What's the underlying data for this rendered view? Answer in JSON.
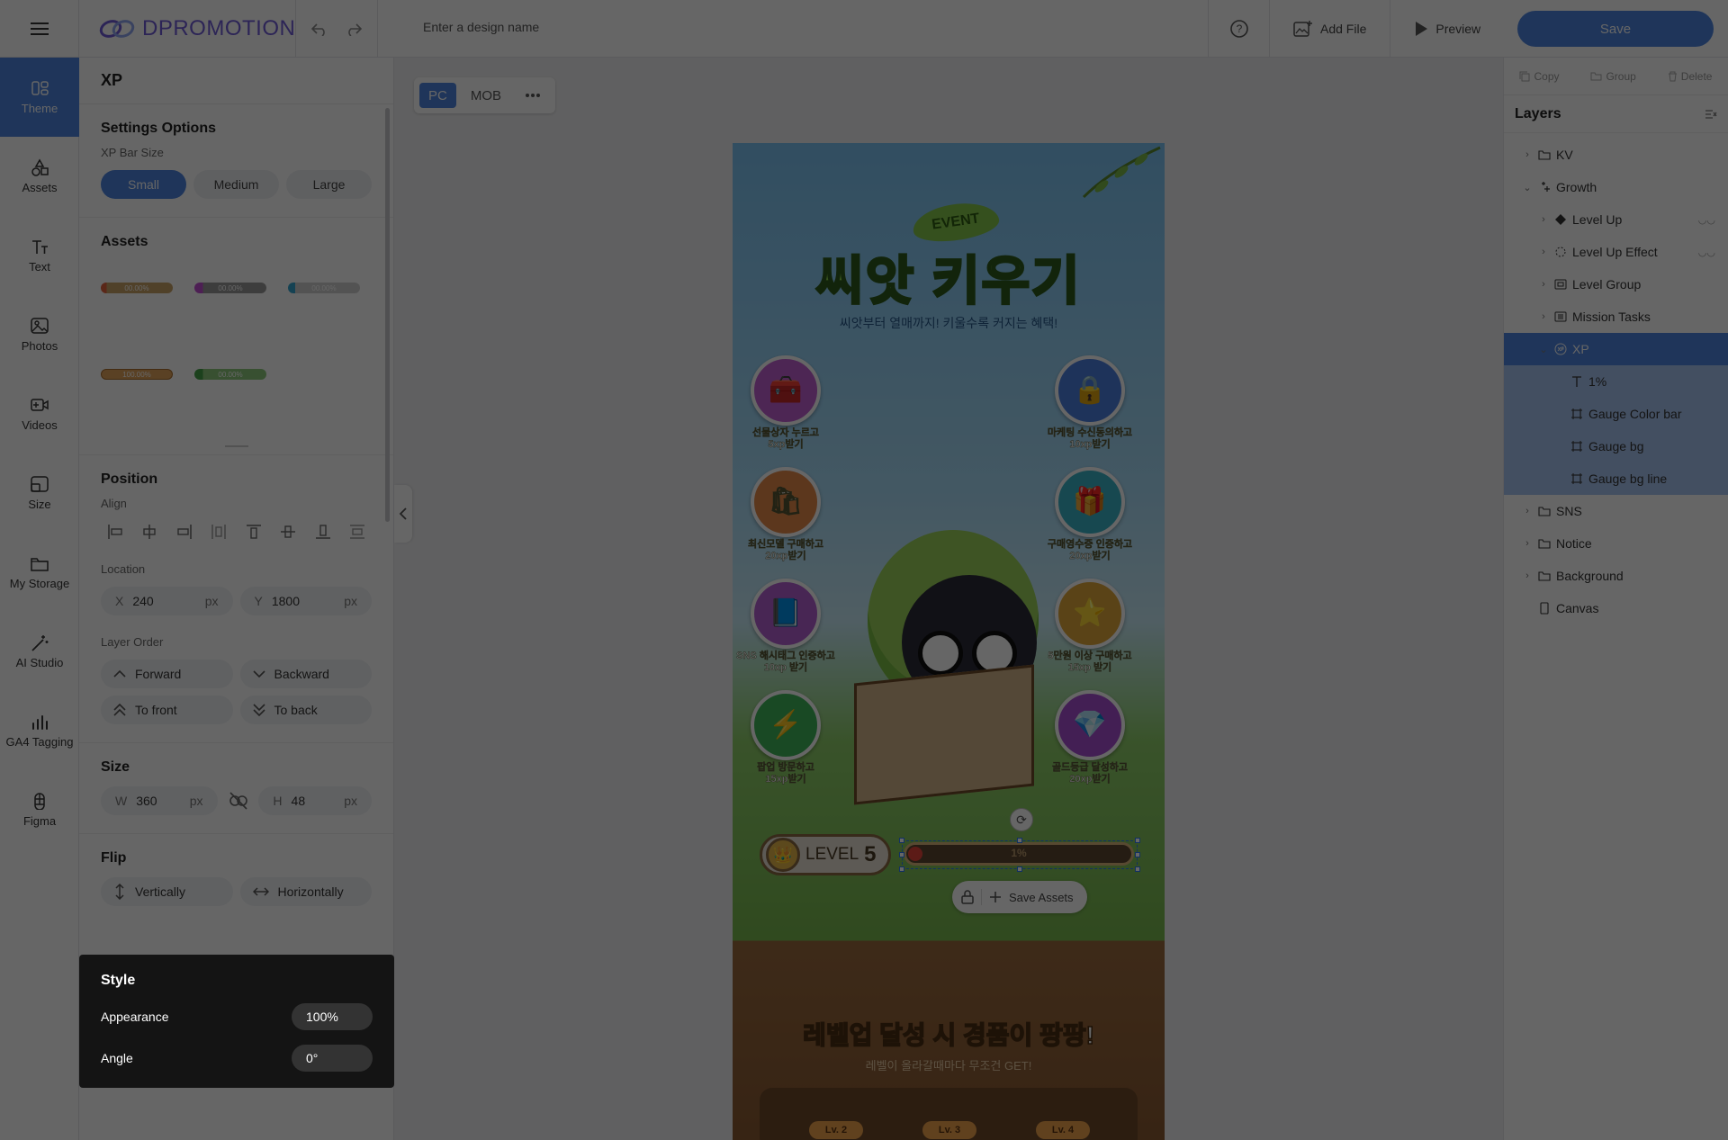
{
  "topbar": {
    "logo": "DPROMOTION",
    "design_name_placeholder": "Enter a design name",
    "add_file": "Add File",
    "preview": "Preview",
    "save": "Save"
  },
  "rail": [
    {
      "label": "Theme",
      "icon": "theme-icon"
    },
    {
      "label": "Assets",
      "icon": "shapes-icon"
    },
    {
      "label": "Text",
      "icon": "text-icon"
    },
    {
      "label": "Photos",
      "icon": "image-icon"
    },
    {
      "label": "Videos",
      "icon": "video-icon"
    },
    {
      "label": "Size",
      "icon": "size-icon"
    },
    {
      "label": "My Storage",
      "icon": "folder-icon"
    },
    {
      "label": "AI Studio",
      "icon": "magic-wand-icon"
    },
    {
      "label": "GA4 Tagging",
      "icon": "chart-icon"
    },
    {
      "label": "Figma",
      "icon": "figma-icon"
    }
  ],
  "panel": {
    "title": "XP",
    "settings_heading": "Settings Options",
    "xp_bar_size_label": "XP Bar Size",
    "sizes": [
      "Small",
      "Medium",
      "Large"
    ],
    "selected_size": "Small",
    "assets_heading": "Assets",
    "asset_labels": [
      "00.00%",
      "00.00%",
      "00.00%",
      "100.00%",
      "00.00%"
    ],
    "position_heading": "Position",
    "align_label": "Align",
    "location_label": "Location",
    "x_key": "X",
    "x_value": "240",
    "y_key": "Y",
    "y_value": "1800",
    "unit": "px",
    "layer_order_label": "Layer Order",
    "forward": "Forward",
    "backward": "Backward",
    "to_front": "To front",
    "to_back": "To back",
    "size_heading": "Size",
    "w_key": "W",
    "w_value": "360",
    "h_key": "H",
    "h_value": "48",
    "flip_heading": "Flip",
    "vertically": "Vertically",
    "horizontally": "Horizontally"
  },
  "style": {
    "heading": "Style",
    "appearance_label": "Appearance",
    "appearance_value": "100%",
    "angle_label": "Angle",
    "angle_value": "0°"
  },
  "canvas": {
    "devices": [
      "PC",
      "MOB"
    ],
    "active_device": "PC",
    "event_badge": "EVENT",
    "title": "씨앗 키우기",
    "subtitle": "씨앗부터 열매까지! 키울수록 커지는 혜택!",
    "missions": [
      {
        "line1": "선물상자 누르고",
        "line2": "5xp받기",
        "icon": "🧰",
        "color": "#c05fd1"
      },
      {
        "line1": "마케팅 수신동의하고",
        "line2": "10xp받기",
        "icon": "🔒",
        "color": "#4d7fe0"
      },
      {
        "line1": "최신모델 구매하고",
        "line2": "20xp받기",
        "icon": "🛍",
        "color": "#e68a4a"
      },
      {
        "line1": "구매영수증 인증하고",
        "line2": "20xp받기",
        "icon": "🎁",
        "color": "#3bb3c9"
      },
      {
        "line1": "SNS 해시태그 인증하고",
        "line2": "10xp 받기",
        "icon": "📘",
        "color": "#b45fd1"
      },
      {
        "line1": "5만원 이상 구매하고",
        "line2": "15xp 받기",
        "icon": "⭐",
        "color": "#e0a93a"
      },
      {
        "line1": "팝업 방문하고",
        "line2": "15xp받기",
        "icon": "⚡",
        "color": "#3fb65a"
      },
      {
        "line1": "골드등급 달성하고",
        "line2": "20xp받기",
        "icon": "💎",
        "color": "#a84fd1"
      }
    ],
    "level_label": "LEVEL",
    "level_value": "5",
    "xp_percent_text": "1%",
    "xp_progress": 0.01,
    "save_assets": "Save Assets",
    "prize_highlight": "레벨업",
    "prize_rest": " 달성 시 경품이 팡팡!",
    "prize_sub": "레벨이 올라갈때마다 무조건 GET!",
    "level_tags": [
      "Lv. 2",
      "Lv. 3",
      "Lv. 4"
    ]
  },
  "right": {
    "copy": "Copy",
    "group": "Group",
    "delete": "Delete",
    "layers_heading": "Layers",
    "layers": [
      {
        "label": "KV",
        "indent": 0,
        "chev": "›",
        "icon": "folder-icon",
        "state": ""
      },
      {
        "label": "Growth",
        "indent": 0,
        "chev": "⌄",
        "icon": "sparkle-icon",
        "state": ""
      },
      {
        "label": "Level Up",
        "indent": 1,
        "chev": "›",
        "icon": "diamond-icon",
        "state": "",
        "hidden": true
      },
      {
        "label": "Level Up Effect",
        "indent": 1,
        "chev": "›",
        "icon": "effect-icon",
        "state": "",
        "hidden": true
      },
      {
        "label": "Level Group",
        "indent": 1,
        "chev": "›",
        "icon": "group-icon",
        "state": ""
      },
      {
        "label": "Mission Tasks",
        "indent": 1,
        "chev": "›",
        "icon": "list-icon",
        "state": ""
      },
      {
        "label": "XP",
        "indent": 1,
        "chev": "⌄",
        "icon": "xp-icon",
        "state": "sel1"
      },
      {
        "label": "1%",
        "indent": 2,
        "chev": "",
        "icon": "text-icon",
        "state": "sel2"
      },
      {
        "label": "Gauge Color bar",
        "indent": 2,
        "chev": "",
        "icon": "frame-icon",
        "state": "sel2"
      },
      {
        "label": "Gauge bg",
        "indent": 2,
        "chev": "",
        "icon": "frame-icon",
        "state": "sel2"
      },
      {
        "label": "Gauge bg line",
        "indent": 2,
        "chev": "",
        "icon": "frame-icon",
        "state": "sel2"
      },
      {
        "label": "SNS",
        "indent": 0,
        "chev": "›",
        "icon": "folder-icon",
        "state": ""
      },
      {
        "label": "Notice",
        "indent": 0,
        "chev": "›",
        "icon": "folder-icon",
        "state": ""
      },
      {
        "label": "Background",
        "indent": 0,
        "chev": "›",
        "icon": "folder-icon",
        "state": ""
      },
      {
        "label": "Canvas",
        "indent": 0,
        "chev": "",
        "icon": "page-icon",
        "state": ""
      }
    ]
  }
}
